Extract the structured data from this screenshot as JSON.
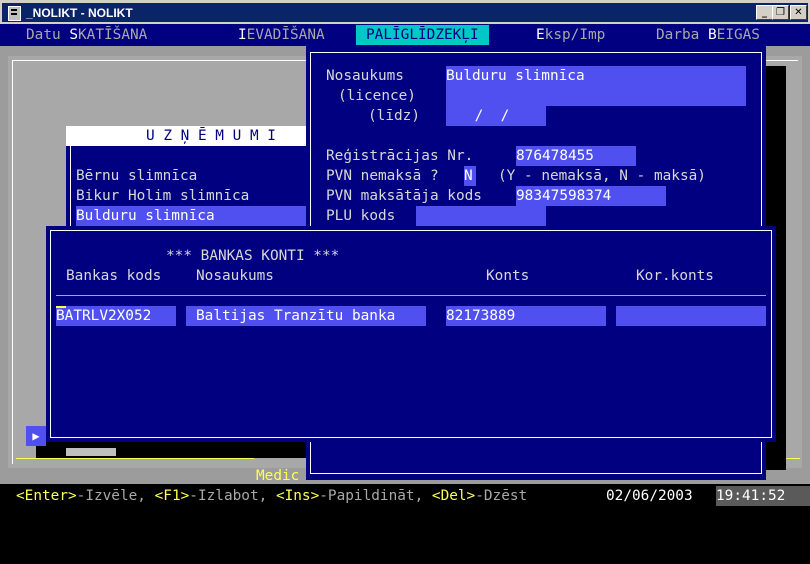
{
  "window": {
    "title": "_NOLIKT - NOLIKT"
  },
  "menu": {
    "items": [
      {
        "prefix": "Datu ",
        "hot": "S",
        "rest": "KATĪŠANA"
      },
      {
        "prefix": "",
        "hot": "I",
        "rest": "EVADĪŠANA"
      },
      {
        "prefix": "",
        "hot": "P",
        "rest": "ALĪGLĪDZEKĻI"
      },
      {
        "prefix": "",
        "hot": "E",
        "rest": "ksp/Imp"
      },
      {
        "prefix": "Darba ",
        "hot": "B",
        "rest": "EIGAS"
      }
    ]
  },
  "companies": {
    "title": "U Z Ņ Ē M U M I",
    "items": [
      "Bērnu slimnīca",
      "Bikur Holim slimnīca",
      "Bulduru slimnīca"
    ],
    "selected_index": 2
  },
  "company_info": {
    "name_label": "Nosaukums",
    "name_value": "Bulduru slimnīca",
    "licence_label": "(licence)",
    "until_label": "(līdz)",
    "until_value": " /  /",
    "reg_label": "Reģistrācijas Nr.",
    "reg_value": "876478455",
    "vat_exempt_label": "PVN nemaksā ?",
    "vat_exempt_value": "N",
    "vat_exempt_hint": "(Y - nemaksā, N - maksā)",
    "vat_code_label": "PVN maksātāja kods",
    "vat_code_value": "98347598374",
    "plu_label": "PLU kods",
    "plu_value": ""
  },
  "bank": {
    "title": "*** BANKAS KONTI ***",
    "columns": [
      "Bankas kods",
      "Nosaukums",
      "Konts",
      "Kor.konts"
    ],
    "rows": [
      {
        "code": "BATRLV2X052",
        "name": "Baltijas Tranzītu banka",
        "account": "82173889",
        "cor_account": ""
      }
    ]
  },
  "footer_partial": "Medic",
  "status": {
    "enter_key": "<Enter>",
    "enter_text": "-Izvēle, ",
    "f1_key": "<F1>",
    "f1_text": "-Izlabot, ",
    "ins_key": "<Ins>",
    "ins_text": "-Papildināt, ",
    "del_key": "<Del>",
    "del_text": "-Dzēst",
    "date": "02/06/2003",
    "time": "19:41:52"
  }
}
